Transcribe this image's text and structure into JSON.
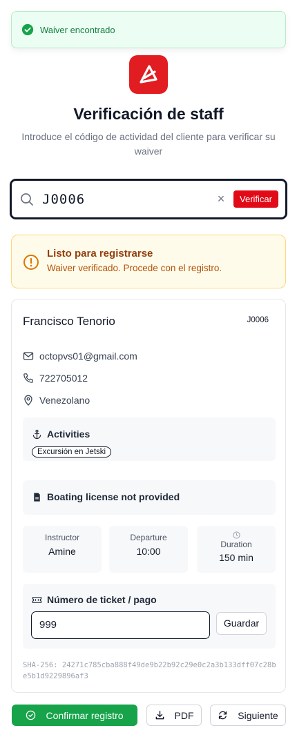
{
  "toast": {
    "message": "Waiver encontrado",
    "color": "#16a34a"
  },
  "brand": {
    "logo_icon": "arrow-triangle-logo",
    "color": "#e11d21"
  },
  "header": {
    "title": "Verificación de staff",
    "subtitle": "Introduce el código de actividad del cliente para verificar su waiver"
  },
  "search": {
    "value": "J0006",
    "clear_icon": "×",
    "button_label": "Verificar"
  },
  "alert": {
    "title": "Listo para registrarse",
    "text": "Waiver verificado. Procede con el registro."
  },
  "customer": {
    "name": "Francisco Tenorio",
    "code": "J0006",
    "email": "octopvs01@gmail.com",
    "phone": "722705012",
    "nationality": "Venezolano"
  },
  "activities": {
    "title": "Activities",
    "items": [
      "Excursión en Jetski"
    ]
  },
  "license": {
    "text": "Boating license not provided"
  },
  "stats": {
    "instructor_label": "Instructor",
    "instructor_value": "Amine",
    "departure_label": "Departure",
    "departure_value": "10:00",
    "duration_label": "Duration",
    "duration_value": "150 min"
  },
  "ticket": {
    "title": "Número de ticket / pago",
    "value": "999",
    "save_label": "Guardar"
  },
  "hash": {
    "text": "SHA-256: 24271c785cba888f49de9b22b92c29e0c2a3b133dff07c28be5b1d9229896af3"
  },
  "actions": {
    "confirm_label": "Confirmar registro",
    "pdf_label": "PDF",
    "next_label": "Siguiente"
  }
}
